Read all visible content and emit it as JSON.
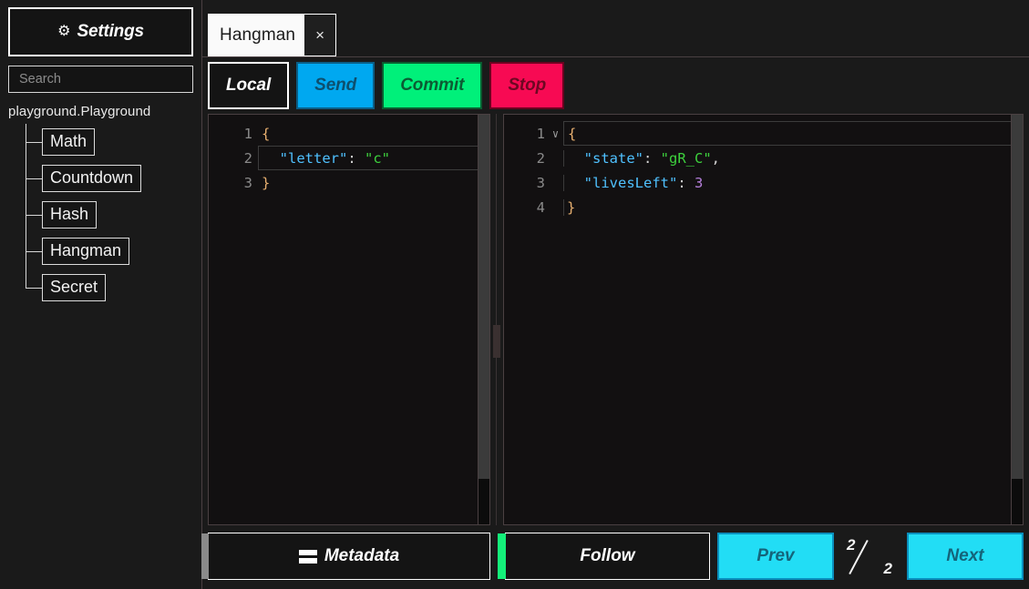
{
  "sidebar": {
    "settings_button": {
      "label": "Settings",
      "icon": "gear-icon"
    },
    "search": {
      "value": "",
      "placeholder": "Search"
    },
    "tree_root_label": "playground.Playground",
    "tree_nodes": [
      {
        "label": "Math"
      },
      {
        "label": "Countdown"
      },
      {
        "label": "Hash"
      },
      {
        "label": "Hangman"
      },
      {
        "label": "Secret"
      }
    ]
  },
  "tabs": [
    {
      "label": "Hangman",
      "close_glyph": "×",
      "active": true
    }
  ],
  "toolbar": {
    "local_label": "Local",
    "send_label": "Send",
    "commit_label": "Commit",
    "stop_label": "Stop",
    "colors": {
      "send": "#00a8f0",
      "commit": "#00f07a",
      "stop": "#f70a53"
    }
  },
  "left_editor": {
    "lines": [
      {
        "number": "1",
        "tokens": [
          {
            "t": "brace",
            "v": "{"
          }
        ]
      },
      {
        "number": "2",
        "active": true,
        "tokens": [
          {
            "t": "key",
            "v": "  \"letter\""
          },
          {
            "t": "punct",
            "v": ": "
          },
          {
            "t": "str",
            "v": "\"c\""
          }
        ]
      },
      {
        "number": "3",
        "tokens": [
          {
            "t": "brace",
            "v": "}"
          }
        ]
      }
    ]
  },
  "right_editor": {
    "lines": [
      {
        "number": "1",
        "active": true,
        "fold": "∨",
        "tokens": [
          {
            "t": "brace",
            "v": "{"
          }
        ]
      },
      {
        "number": "2",
        "tokens": [
          {
            "t": "key",
            "v": "  \"state\""
          },
          {
            "t": "punct",
            "v": ": "
          },
          {
            "t": "str",
            "v": "\"gR_C\""
          },
          {
            "t": "punct",
            "v": ","
          }
        ]
      },
      {
        "number": "3",
        "tokens": [
          {
            "t": "key",
            "v": "  \"livesLeft\""
          },
          {
            "t": "punct",
            "v": ": "
          },
          {
            "t": "num",
            "v": "3"
          }
        ]
      },
      {
        "number": "4",
        "tokens": [
          {
            "t": "brace",
            "v": "}"
          }
        ]
      }
    ]
  },
  "bottombar": {
    "metadata_label": "Metadata",
    "metadata_icon": "stacked-bars-icon",
    "follow_label": "Follow",
    "prev_label": "Prev",
    "next_label": "Next",
    "pager_current": "2",
    "pager_total": "2"
  }
}
